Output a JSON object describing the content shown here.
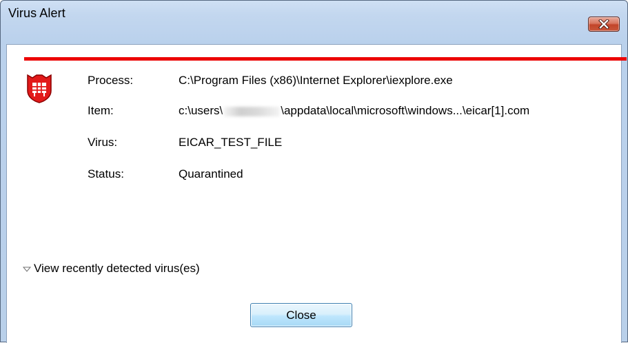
{
  "window": {
    "title": "Virus Alert"
  },
  "alert": {
    "accent_color": "#ec0000",
    "icon": "red-shield-icon",
    "rows": [
      {
        "label": "Process:",
        "value": "C:\\Program Files (x86)\\Internet Explorer\\iexplore.exe"
      },
      {
        "label": "Item:",
        "value_prefix": "c:\\users\\",
        "value_suffix": "\\appdata\\local\\microsoft\\windows...\\eicar[1].com"
      },
      {
        "label": "Virus:",
        "value": "EICAR_TEST_FILE"
      },
      {
        "label": "Status:",
        "value": "Quarantined"
      }
    ]
  },
  "expander": {
    "icon": "expand-arrow-icon",
    "label": "View recently detected virus(es)"
  },
  "buttons": {
    "close_label": "Close"
  }
}
